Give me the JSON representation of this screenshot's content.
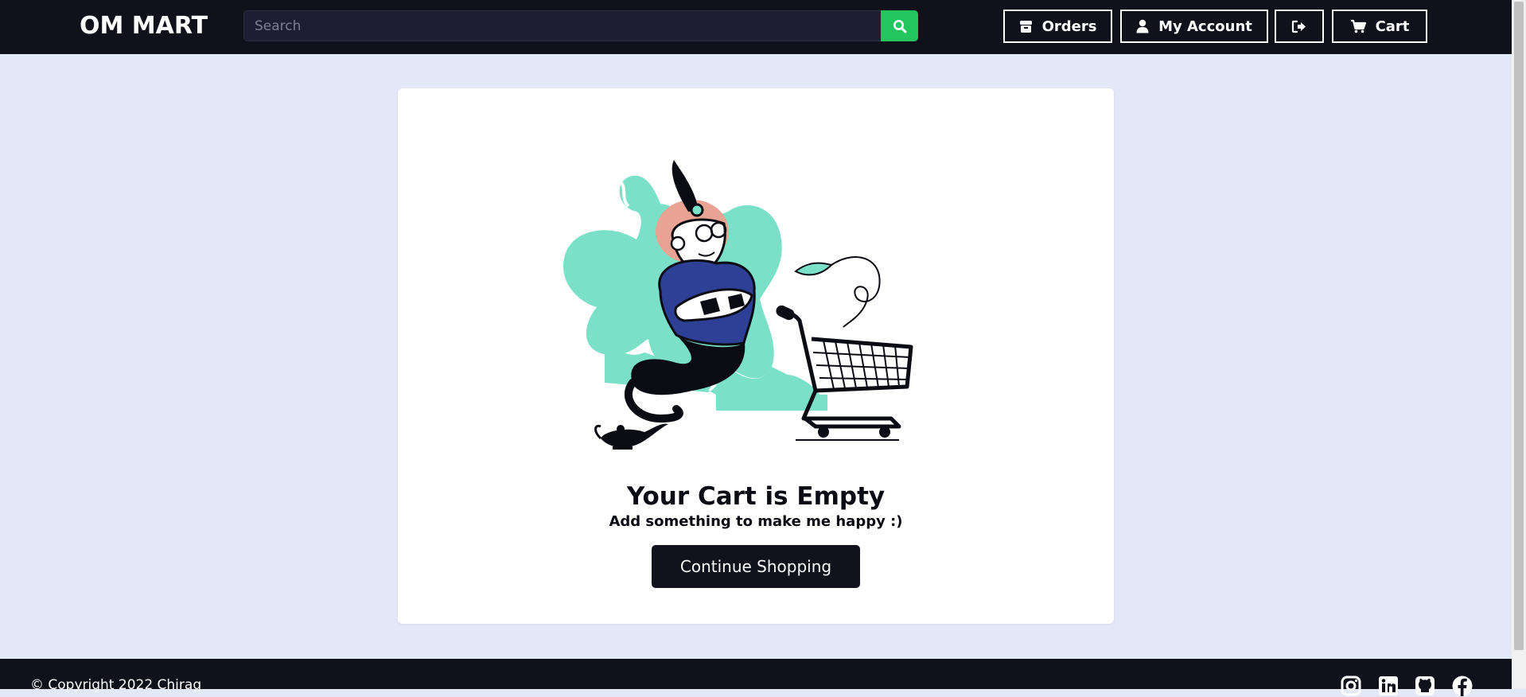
{
  "header": {
    "brand": "OM MART",
    "search": {
      "placeholder": "Search",
      "value": ""
    },
    "nav": {
      "orders_label": "Orders",
      "account_label": "My Account",
      "cart_label": "Cart"
    }
  },
  "main": {
    "title": "Your Cart is Empty",
    "subtitle": "Add something to make me happy :)",
    "continue_label": "Continue Shopping"
  },
  "footer": {
    "copyright": "© Copyright 2022 Chirag",
    "social_icons": [
      "instagram-icon",
      "linkedin-icon",
      "github-icon",
      "facebook-icon"
    ]
  },
  "colors": {
    "header_bg": "#11111c",
    "page_bg": "#e3e8f6",
    "search_button": "#22c55e",
    "illustration_mint": "#7ae0c8",
    "illustration_blue": "#2e3f96",
    "illustration_salmon": "#e8a394"
  }
}
